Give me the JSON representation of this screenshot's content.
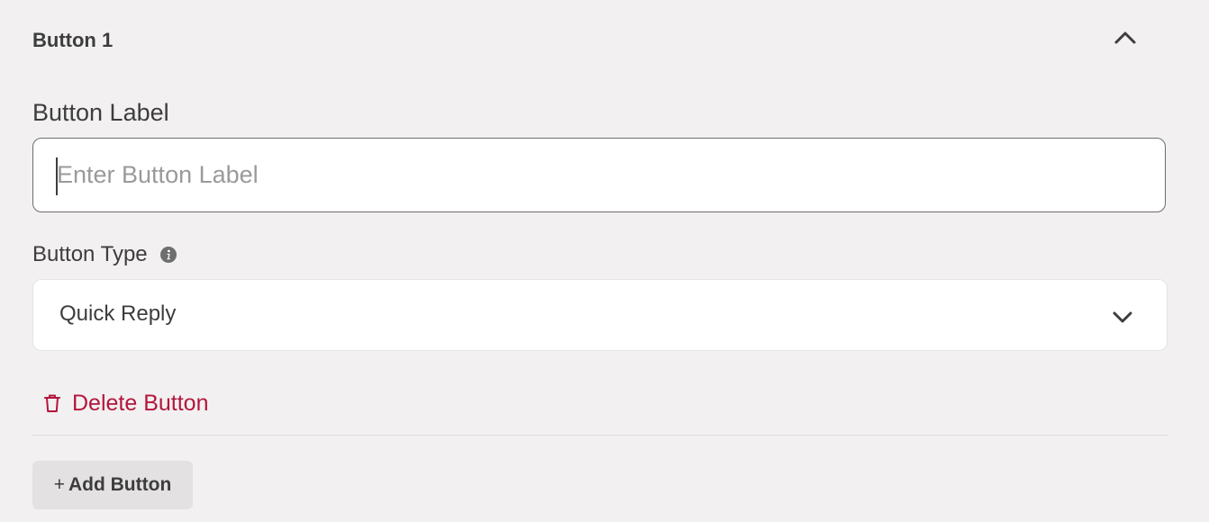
{
  "section": {
    "title": "Button 1"
  },
  "label_field": {
    "label": "Button Label",
    "placeholder": "Enter Button Label",
    "value": ""
  },
  "type_field": {
    "label": "Button Type",
    "selected": "Quick Reply"
  },
  "actions": {
    "delete_label": "Delete Button",
    "add_plus": "+",
    "add_label": "Add Button"
  },
  "colors": {
    "background": "#f2f0f1",
    "danger": "#b3163c",
    "text": "#3d3d3d"
  },
  "icons": {
    "collapse": "chevron-up-icon",
    "info": "info-icon",
    "dropdown": "chevron-down-icon",
    "delete": "trash-icon"
  }
}
